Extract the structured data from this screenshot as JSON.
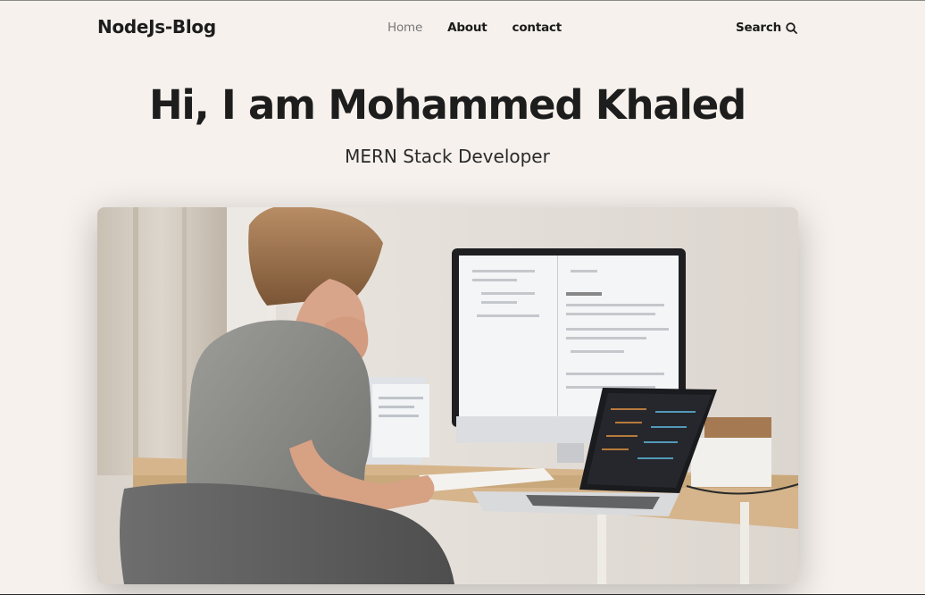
{
  "header": {
    "logo": "NodeJs-Blog",
    "nav": [
      {
        "label": "Home",
        "active": true
      },
      {
        "label": "About",
        "active": false
      },
      {
        "label": "contact",
        "active": false
      }
    ],
    "search_label": "Search"
  },
  "hero": {
    "title": "Hi, I am Mohammed Khaled",
    "subtitle": "MERN Stack Developer"
  },
  "colors": {
    "background": "#f6f1ec",
    "text": "#1c1c1c",
    "nav_active": "#777777"
  }
}
